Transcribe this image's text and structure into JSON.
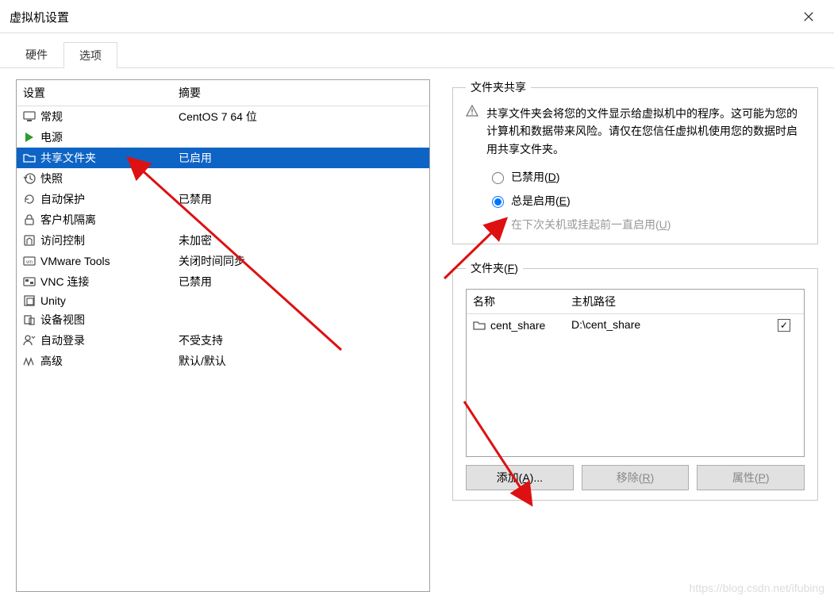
{
  "titlebar": {
    "title": "虚拟机设置"
  },
  "tabs": {
    "hardware": "硬件",
    "options": "选项"
  },
  "left": {
    "header_setting": "设置",
    "header_summary": "摘要",
    "rows": [
      {
        "icon": "monitor",
        "label": "常规",
        "summary": "CentOS 7 64 位"
      },
      {
        "icon": "play",
        "label": "电源",
        "summary": ""
      },
      {
        "icon": "folder",
        "label": "共享文件夹",
        "summary": "已启用",
        "selected": true
      },
      {
        "icon": "history",
        "label": "快照",
        "summary": ""
      },
      {
        "icon": "refresh",
        "label": "自动保护",
        "summary": "已禁用"
      },
      {
        "icon": "lock",
        "label": "客户机隔离",
        "summary": ""
      },
      {
        "icon": "shield",
        "label": "访问控制",
        "summary": "未加密"
      },
      {
        "icon": "vm",
        "label": "VMware Tools",
        "summary": "关闭时间同步"
      },
      {
        "icon": "vnc",
        "label": "VNC 连接",
        "summary": "已禁用"
      },
      {
        "icon": "unity",
        "label": "Unity",
        "summary": ""
      },
      {
        "icon": "device",
        "label": "设备视图",
        "summary": ""
      },
      {
        "icon": "autologin",
        "label": "自动登录",
        "summary": "不受支持"
      },
      {
        "icon": "advanced",
        "label": "高级",
        "summary": "默认/默认"
      }
    ]
  },
  "share_box": {
    "legend": "文件夹共享",
    "warning": "共享文件夹会将您的文件显示给虚拟机中的程序。这可能为您的计算机和数据带来风险。请仅在您信任虚拟机使用您的数据时启用共享文件夹。",
    "radio_disabled_prefix": "已禁用(",
    "radio_disabled_key": "D",
    "radio_disabled_suffix": ")",
    "radio_always_prefix": "总是启用(",
    "radio_always_key": "E",
    "radio_always_suffix": ")",
    "radio_until_prefix": "在下次关机或挂起前一直启用(",
    "radio_until_key": "U",
    "radio_until_suffix": ")"
  },
  "folders_box": {
    "legend_prefix": "文件夹(",
    "legend_key": "F",
    "legend_suffix": ")",
    "col_name": "名称",
    "col_hostpath": "主机路径",
    "rows": [
      {
        "name": "cent_share",
        "hostpath": "D:\\cent_share",
        "checked": true
      }
    ],
    "btn_add_prefix": "添加(",
    "btn_add_key": "A",
    "btn_add_suffix": ")...",
    "btn_remove_prefix": "移除(",
    "btn_remove_key": "R",
    "btn_remove_suffix": ")",
    "btn_props_prefix": "属性(",
    "btn_props_key": "P",
    "btn_props_suffix": ")"
  },
  "watermark": "https://blog.csdn.net/ifubing"
}
